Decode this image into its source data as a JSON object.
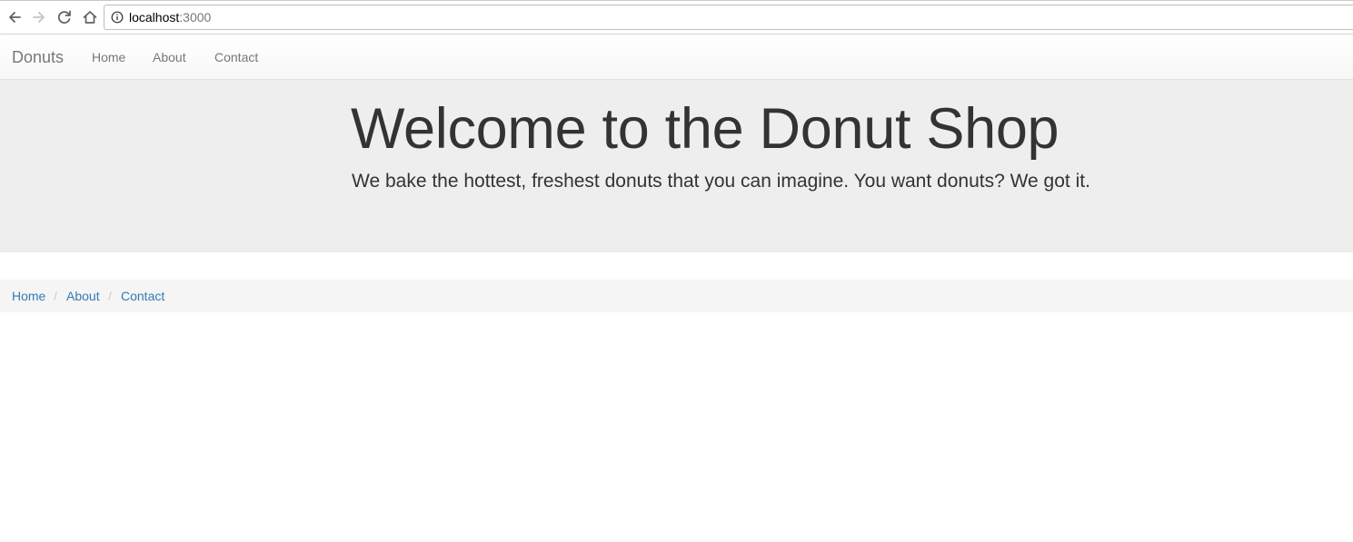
{
  "browser": {
    "url_host": "localhost",
    "url_port": ":3000",
    "icons": [
      "back-arrow-icon",
      "forward-arrow-icon",
      "reload-icon",
      "home-icon",
      "info-icon"
    ]
  },
  "navbar": {
    "brand": "Donuts",
    "links": [
      {
        "label": "Home"
      },
      {
        "label": "About"
      },
      {
        "label": "Contact"
      }
    ]
  },
  "jumbotron": {
    "title": "Welcome to the Donut Shop",
    "text": "We bake the hottest, freshest donuts that you can imagine. You want donuts? We got it."
  },
  "breadcrumb": {
    "separator": "/",
    "items": [
      {
        "label": "Home"
      },
      {
        "label": "About"
      },
      {
        "label": "Contact"
      }
    ]
  },
  "colors": {
    "link": "#337ab7",
    "nav_text": "#777777",
    "heading": "#333333",
    "jumbotron_bg": "#eeeeee",
    "breadcrumb_bg": "#f5f5f5"
  }
}
